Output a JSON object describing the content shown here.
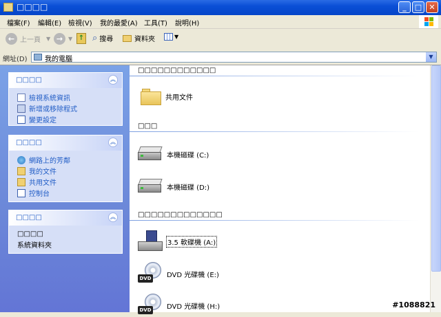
{
  "window": {
    "title": "□□□□"
  },
  "menu": {
    "file": "檔案(F)",
    "edit": "編輯(E)",
    "view": "檢視(V)",
    "favorites": "我的最愛(A)",
    "tools": "工具(T)",
    "help": "說明(H)"
  },
  "toolbar": {
    "back": "上一頁",
    "search": "搜尋",
    "folders": "資料夾"
  },
  "address": {
    "label": "網址(D)",
    "value": "我的電腦"
  },
  "left": {
    "panel1": {
      "title": "□□□□",
      "links": [
        "檢視系統資訊",
        "新增或移除程式",
        "變更設定"
      ]
    },
    "panel2": {
      "title": "□□□□",
      "links": [
        "網路上的芳鄰",
        "我的文件",
        "共用文件",
        "控制台"
      ]
    },
    "panel3": {
      "title": "□□□□",
      "details_title": "□□□□",
      "details_sub": "系統資料夾"
    }
  },
  "content": {
    "group1": {
      "header": "□□□□□□□□□□□□",
      "items": [
        "共用文件"
      ]
    },
    "group2": {
      "header": "□□□",
      "items": [
        "本機磁碟 (C:)",
        "本機磁碟 (D:)"
      ]
    },
    "group3": {
      "header": "□□□□□□□□□□□□□",
      "items": [
        "3.5 軟碟機 (A:)",
        "DVD 光碟機 (E:)",
        "DVD 光碟機 (H:)"
      ]
    }
  },
  "watermark": "#1088821"
}
